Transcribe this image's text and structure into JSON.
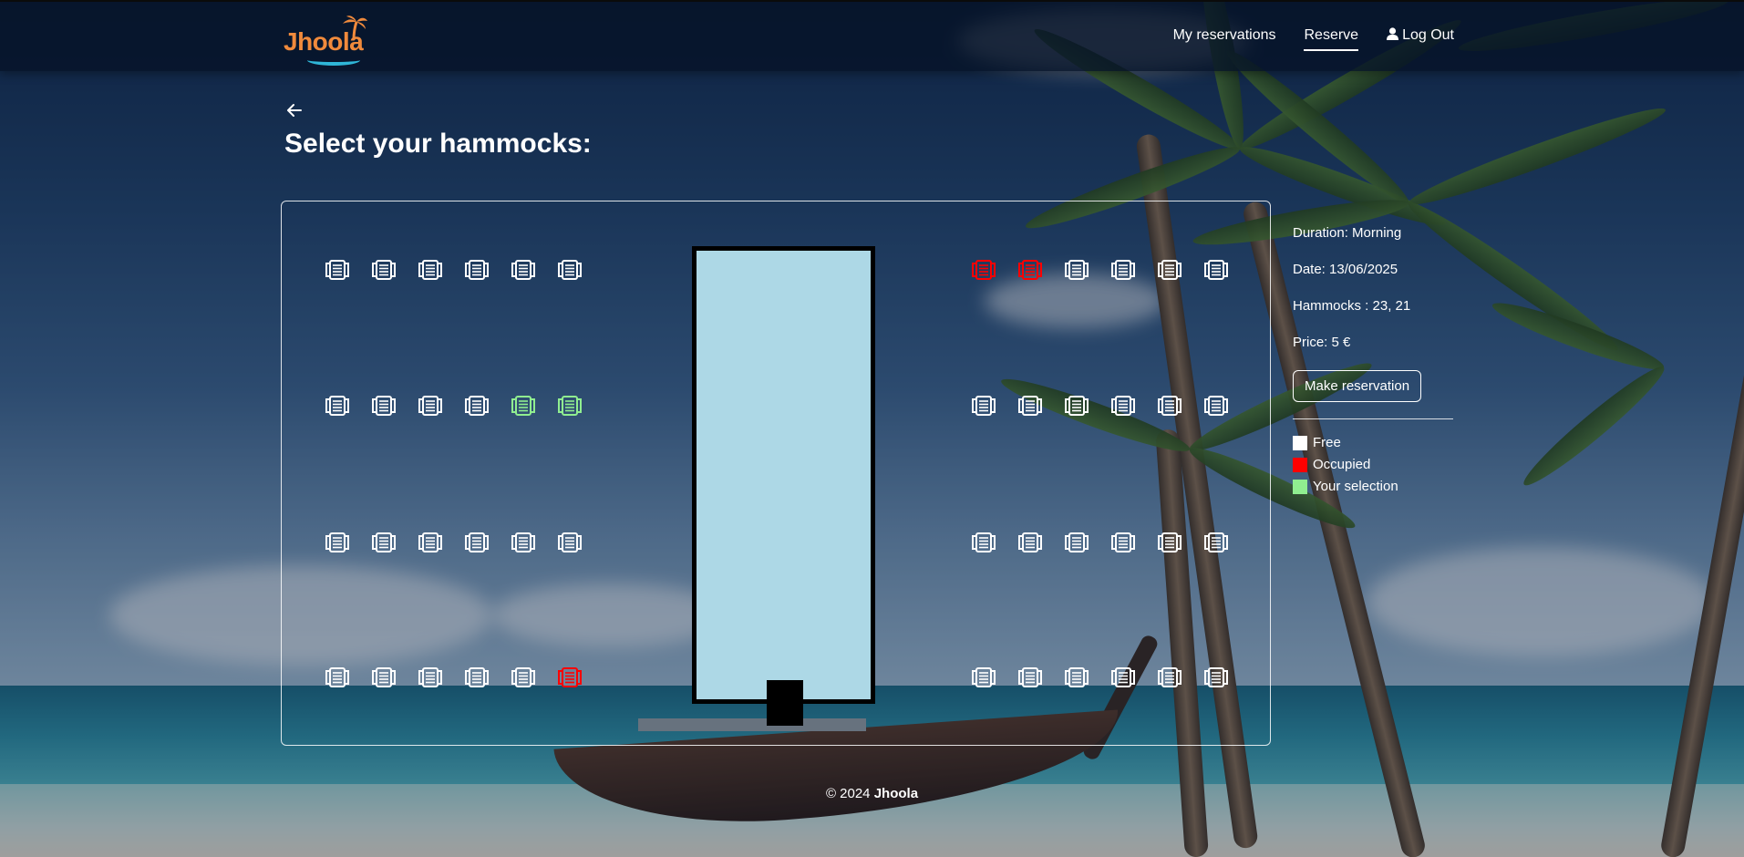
{
  "navbar": {
    "brand": "Jhoola",
    "links": [
      {
        "label": "My reservations",
        "active": false
      },
      {
        "label": "Reserve",
        "active": true
      },
      {
        "label": "Log Out",
        "active": false
      }
    ]
  },
  "page": {
    "title": "Select your hammocks:"
  },
  "hammock_colors": {
    "free": "#ffffff",
    "occupied": "#ff0000",
    "selected": "#90ee90"
  },
  "hammocks": {
    "left_rows": [
      [
        "free",
        "free",
        "free",
        "free",
        "free",
        "free"
      ],
      [
        "free",
        "free",
        "free",
        "free",
        "selected",
        "selected"
      ],
      [
        "free",
        "free",
        "free",
        "free",
        "free",
        "free"
      ],
      [
        "free",
        "free",
        "free",
        "free",
        "free",
        "occupied"
      ]
    ],
    "right_rows": [
      [
        "occupied",
        "occupied",
        "free",
        "free",
        "free",
        "free"
      ],
      [
        "free",
        "free",
        "free",
        "free",
        "free",
        "free"
      ],
      [
        "free",
        "free",
        "free",
        "free",
        "free",
        "free"
      ],
      [
        "free",
        "free",
        "free",
        "free",
        "free",
        "free"
      ]
    ]
  },
  "pool": {
    "color": "#add8e6"
  },
  "info": {
    "duration": "Duration: Morning",
    "date": "Date: 13/06/2025",
    "hammocks": "Hammocks : 23, 21",
    "price": "Price: 5 €",
    "button": "Make reservation"
  },
  "legend": [
    {
      "label": "Free",
      "color": "#ffffff"
    },
    {
      "label": "Occupied",
      "color": "#ff0000"
    },
    {
      "label": "Your selection",
      "color": "#90ee90"
    }
  ],
  "footer": {
    "copyright": "© 2024",
    "brand": "Jhoola"
  }
}
